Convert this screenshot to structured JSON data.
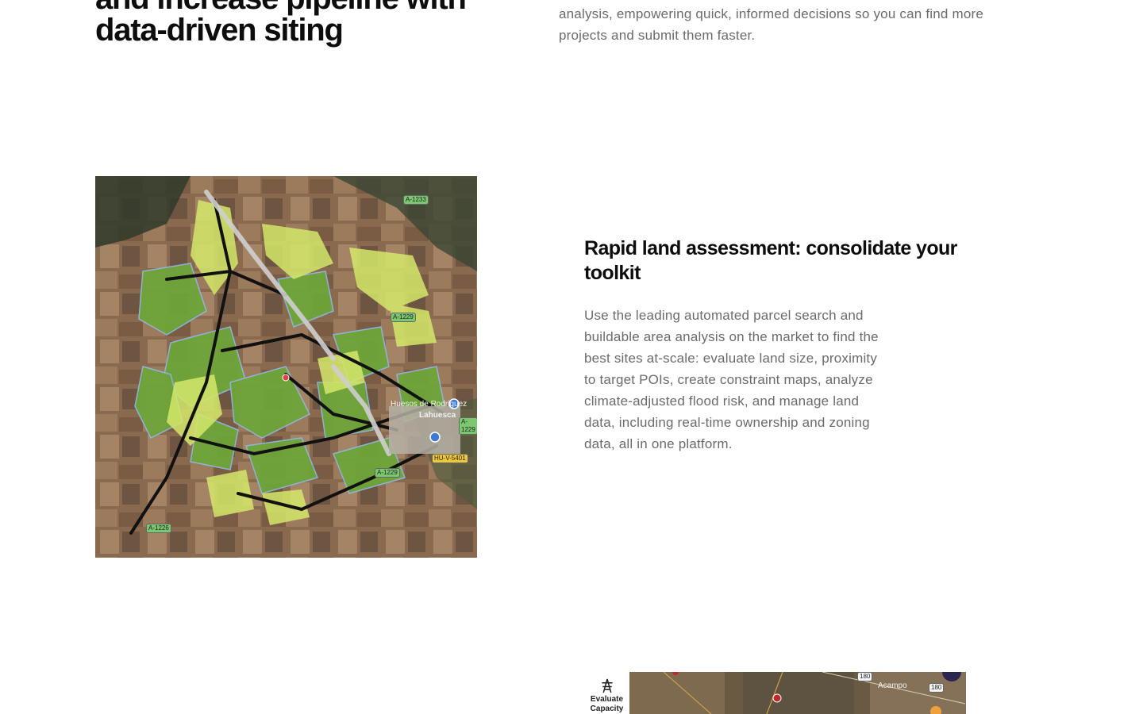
{
  "hero": {
    "title": "and increase pipeline with\ndata-driven siting",
    "description": "analysis, empowering quick, informed decisions so you can find more\nprojects and submit them faster."
  },
  "feature": {
    "title": "Rapid land assessment: consolidate your toolkit",
    "description": "Use the leading automated parcel search and buildable area analysis on the market to find the best sites at-scale: evaluate land size, proximity to target POIs, create constraint maps, analyze climate-adjusted flood risk, and manage land data, including real-time ownership and zoning data, all in one platform."
  },
  "map_a": {
    "labels": {
      "town": "Lahuesca",
      "place": "Huesos de Rodriguez",
      "road_1": "A-1233",
      "road_2": "A-1229",
      "road_3": "A-1229",
      "road_4": "A-1226",
      "road_5": "A-1229",
      "road_6": "HU-V-5401"
    },
    "colors": {
      "parcel_green": "#6fa53a",
      "buildable_yellow": "#d4e86a",
      "boundary_blue": "#8fb7e0"
    }
  },
  "map_b": {
    "tool_icon": "transmission-tower-icon",
    "tool_label": "Evaluate\nCapacity",
    "labels": {
      "town": "Acampo",
      "road_1": "180",
      "road_2": "180"
    }
  }
}
